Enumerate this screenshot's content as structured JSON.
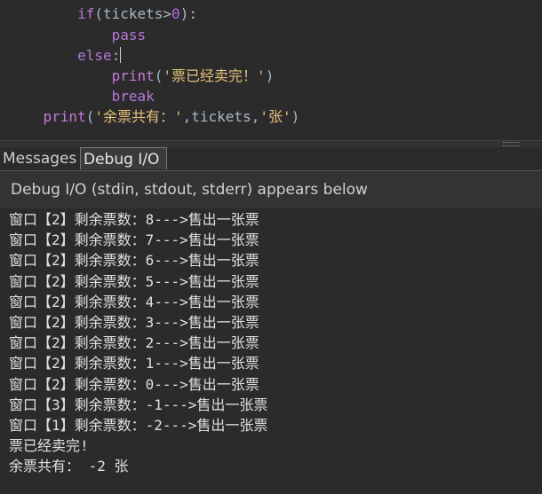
{
  "editor": {
    "lines": [
      {
        "indent": "        ",
        "parts": [
          [
            "kw2",
            "if"
          ],
          [
            "pl",
            "("
          ],
          [
            "pl",
            "tickets"
          ],
          [
            "pl",
            ">"
          ],
          [
            "num",
            "0"
          ],
          [
            "pl",
            "):"
          ]
        ]
      },
      {
        "indent": "            ",
        "parts": [
          [
            "kw2",
            "pass"
          ]
        ]
      },
      {
        "indent": "        ",
        "parts": [
          [
            "kw2",
            "else"
          ],
          [
            "pl",
            ":"
          ]
        ]
      },
      {
        "indent": "            ",
        "parts": [
          [
            "fn",
            "print"
          ],
          [
            "pl",
            "("
          ],
          [
            "str",
            "'票已经卖完！'"
          ],
          [
            "pl",
            ")"
          ]
        ]
      },
      {
        "indent": "            ",
        "parts": [
          [
            "kw2",
            "break"
          ]
        ]
      },
      {
        "indent": "    ",
        "parts": [
          [
            "fn",
            "print"
          ],
          [
            "pl",
            "("
          ],
          [
            "str",
            "'余票共有：'"
          ],
          [
            "pl",
            ","
          ],
          [
            "pl",
            "tickets"
          ],
          [
            "pl",
            ","
          ],
          [
            "str",
            "'张'"
          ],
          [
            "pl",
            ")"
          ]
        ]
      }
    ]
  },
  "tabs": {
    "messages": "Messages",
    "debug_io": "Debug I/O"
  },
  "panel": {
    "header": "Debug I/O (stdin, stdout, stderr) appears below"
  },
  "output": {
    "lines": [
      "窗口【2】剩余票数：8--->售出一张票",
      "窗口【2】剩余票数：7--->售出一张票",
      "窗口【2】剩余票数：6--->售出一张票",
      "窗口【2】剩余票数：5--->售出一张票",
      "窗口【2】剩余票数：4--->售出一张票",
      "窗口【2】剩余票数：3--->售出一张票",
      "窗口【2】剩余票数：2--->售出一张票",
      "窗口【2】剩余票数：1--->售出一张票",
      "窗口【2】剩余票数：0--->售出一张票",
      "窗口【3】剩余票数：-1--->售出一张票",
      "窗口【1】剩余票数：-2--->售出一张票",
      "票已经卖完!",
      "余票共有： -2 张"
    ]
  },
  "colors": {
    "background": "#2b2b2b",
    "keyword": "#b677d9",
    "string": "#e6c07b",
    "number": "#b76be0"
  }
}
